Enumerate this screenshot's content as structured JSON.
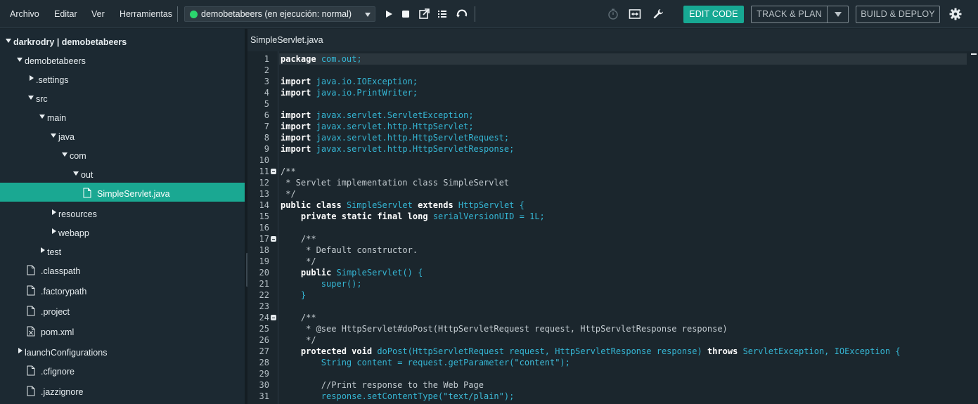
{
  "menubar": {
    "items": [
      "Archivo",
      "Editar",
      "Ver",
      "Herramientas"
    ],
    "project_selector": {
      "value": "demobetabeers (en ejecución: normal)",
      "status_color": "#2bd66e"
    },
    "controls": [
      "play-icon",
      "stop-icon",
      "external-link-icon",
      "list-icon",
      "refresh-icon"
    ],
    "right_icons": [
      "clock-icon",
      "expand-horizontal-icon",
      "wrench-icon",
      "gear-icon"
    ],
    "buttons": {
      "edit": "EDIT CODE",
      "track": "TRACK & PLAN",
      "build": "BUILD & DEPLOY"
    },
    "accent_color": "#17a893"
  },
  "tree": {
    "items": [
      {
        "label": "darkrodry | demobetabeers",
        "toggle": "open"
      },
      {
        "label": "demobetabeers",
        "toggle": "open"
      },
      {
        "label": ".settings",
        "toggle": "closed"
      },
      {
        "label": "src",
        "toggle": "open"
      },
      {
        "label": "main",
        "toggle": "open"
      },
      {
        "label": "java",
        "toggle": "open"
      },
      {
        "label": "com",
        "toggle": "open"
      },
      {
        "label": "out",
        "toggle": "open"
      },
      {
        "label": "SimpleServlet.java",
        "toggle": "file",
        "selected": true
      },
      {
        "label": "resources",
        "toggle": "closed"
      },
      {
        "label": "webapp",
        "toggle": "closed"
      },
      {
        "label": "test",
        "toggle": "closed"
      },
      {
        "label": ".classpath",
        "toggle": "file"
      },
      {
        "label": ".factorypath",
        "toggle": "file"
      },
      {
        "label": ".project",
        "toggle": "file"
      },
      {
        "label": "pom.xml",
        "toggle": "xml-file"
      },
      {
        "label": "launchConfigurations",
        "toggle": "closed"
      },
      {
        "label": ".cfignore",
        "toggle": "file"
      },
      {
        "label": ".jazzignore",
        "toggle": "file"
      }
    ]
  },
  "editor": {
    "tab_title": "SimpleServlet.java",
    "fold_lines": [
      11,
      17,
      24
    ],
    "current_line": 1,
    "lines": [
      "package com.out;",
      "",
      "import java.io.IOException;",
      "import java.io.PrintWriter;",
      "",
      "import javax.servlet.ServletException;",
      "import javax.servlet.http.HttpServlet;",
      "import javax.servlet.http.HttpServletRequest;",
      "import javax.servlet.http.HttpServletResponse;",
      "",
      "/**",
      " * Servlet implementation class SimpleServlet",
      " */",
      "public class SimpleServlet extends HttpServlet {",
      "    private static final long serialVersionUID = 1L;",
      "",
      "    /**",
      "     * Default constructor.",
      "     */",
      "    public SimpleServlet() {",
      "        super();",
      "    }",
      "",
      "    /**",
      "     * @see HttpServlet#doPost(HttpServletRequest request, HttpServletResponse response)",
      "     */",
      "    protected void doPost(HttpServletRequest request, HttpServletResponse response) throws ServletException, IOException {",
      "        String content = request.getParameter(\"content\");",
      "",
      "        //Print response to the Web Page",
      "        response.setContentType(\"text/plain\");"
    ]
  }
}
